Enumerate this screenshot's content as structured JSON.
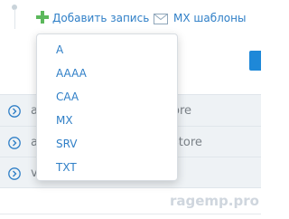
{
  "toolbar": {
    "add_record_label": "Добавить запись",
    "mx_templates_label": "MX шаблоны"
  },
  "menu": {
    "items": [
      "A",
      "AAAA",
      "CAA",
      "MX",
      "SRV",
      "TXT"
    ]
  },
  "table": {
    "rows": [
      {
        "lead": "a",
        "tail": "ore"
      },
      {
        "lead": "a",
        "tail": "store"
      },
      {
        "lead": "v",
        "tail": ""
      }
    ]
  },
  "watermark": "ragemp.pro",
  "colors": {
    "link": "#2f7fc7",
    "plus": "#5cb85c",
    "accent": "#1e88d8"
  }
}
